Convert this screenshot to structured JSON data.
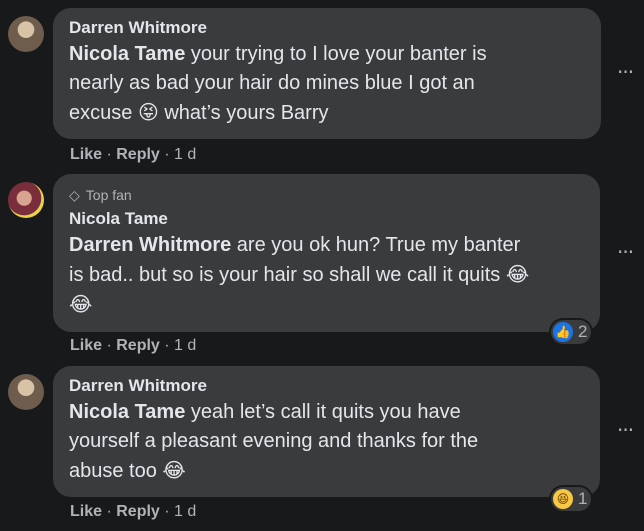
{
  "comments": [
    {
      "author": "Darren Whitmore",
      "mention": "Nicola Tame",
      "line1": " your trying to I love your banter is",
      "line2": "nearly as bad your hair do mines blue I got an",
      "line3a": "excuse ",
      "emoji1": "😝",
      "line3b": " what’s yours Barry",
      "like_label": "Like",
      "reply_label": "Reply",
      "time": "1 d"
    },
    {
      "badge": "Top fan",
      "author": "Nicola Tame",
      "mention": "Darren Whitmore",
      "line1": " are you ok hun? True my banter",
      "line2a": "is bad.. but so is your hair so shall we call it quits ",
      "emoji1": "😂",
      "emoji2": "😂",
      "reaction_count": "2",
      "like_label": "Like",
      "reply_label": "Reply",
      "time": "1 d"
    },
    {
      "author": "Darren Whitmore",
      "mention": "Nicola Tame",
      "line1": " yeah let’s call it quits you have",
      "line2": "yourself a pleasant evening and thanks for the",
      "line3a": "abuse too ",
      "emoji1": "😂",
      "reaction_count": "1",
      "like_label": "Like",
      "reply_label": "Reply",
      "time": "1 d"
    }
  ],
  "separator": " · ",
  "more_glyph": "···",
  "icons": {
    "like": "👍",
    "haha": "😆",
    "gem": "◇"
  }
}
